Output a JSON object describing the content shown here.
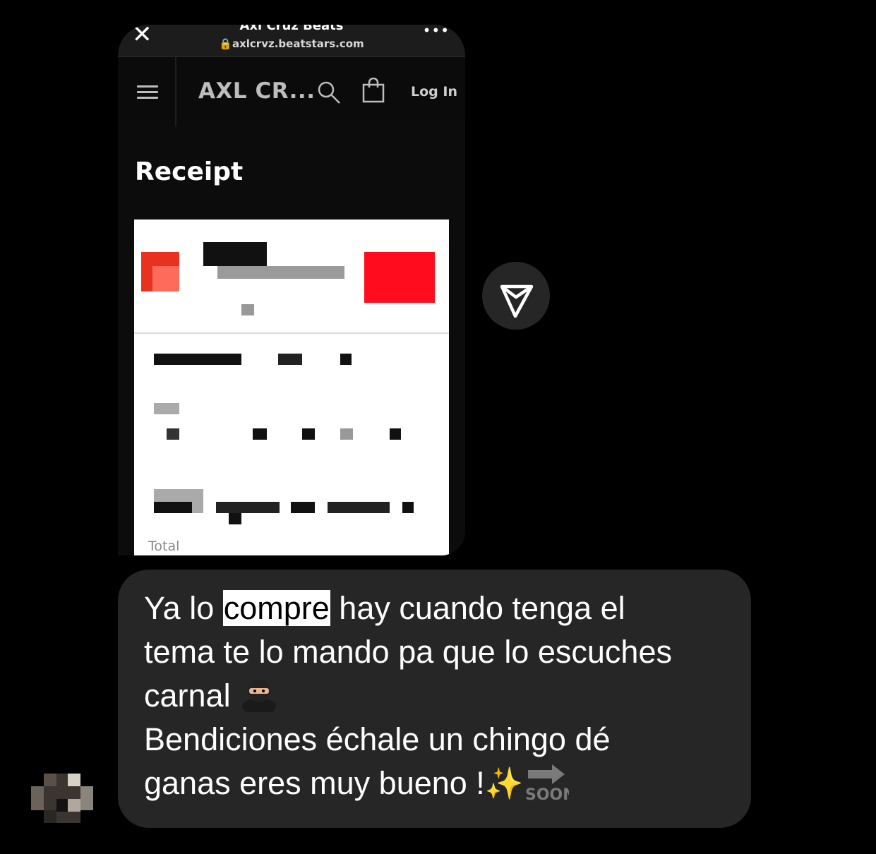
{
  "browser": {
    "close_glyph": "✕",
    "page_title": "Axl Cruz Beats",
    "url": "🔒axlcrvz.beatstars.com",
    "more_glyph": "•••"
  },
  "site": {
    "brand": "AXL CR...",
    "login_label": "Log In"
  },
  "receipt": {
    "heading": "Receipt",
    "total_label": "Total"
  },
  "message": {
    "line1_before": "Ya lo ",
    "line1_highlight": "compre",
    "line1_after": " hay cuando tenga el",
    "line2": "tema te lo mando pa que lo escuches",
    "line3": "carnal ",
    "line4": "Bendiciones échale un chingo dé",
    "line5": "ganas eres muy bueno !",
    "sparkle": "✨"
  },
  "icons": {
    "send": "send-icon",
    "search": "search-icon",
    "bag": "shopping-bag-icon",
    "menu": "menu-icon",
    "ninja": "ninja-emoji",
    "soon": "soon-arrow-emoji"
  },
  "colors": {
    "background": "#000000",
    "bubble": "#262626",
    "highlight_bg": "#ffffff",
    "brand_red": "#ff0d1f"
  }
}
